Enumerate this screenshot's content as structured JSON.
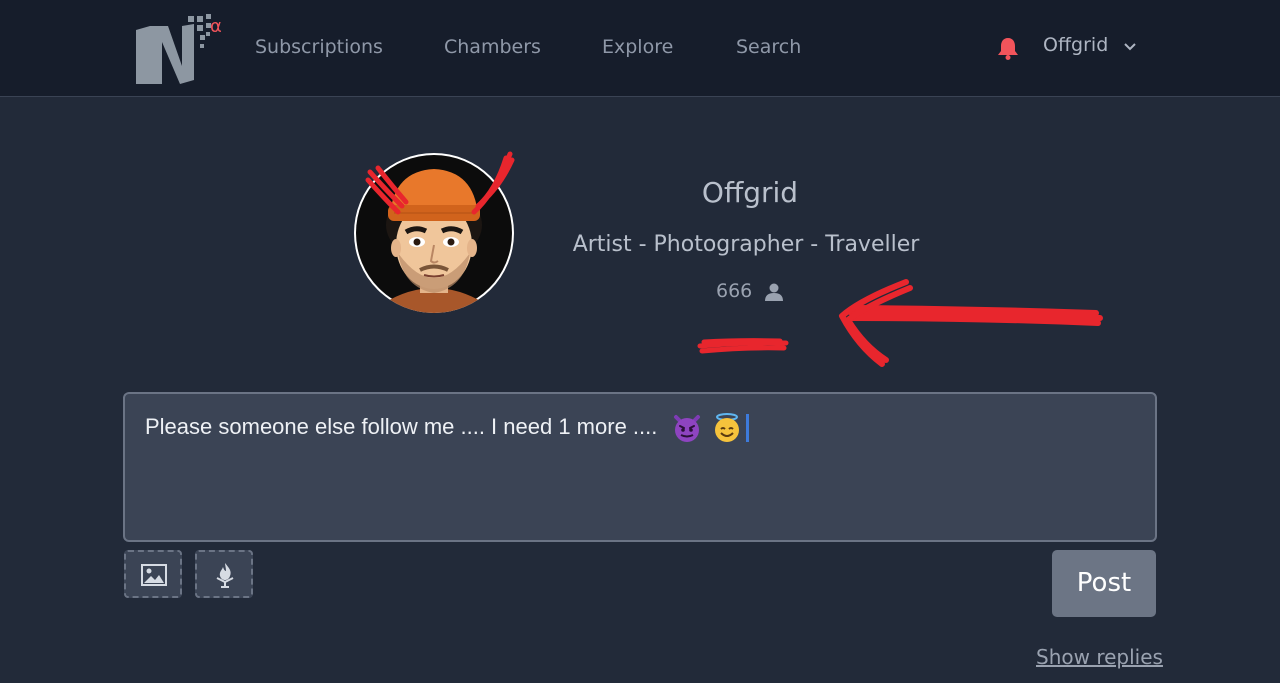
{
  "nav": {
    "logo_superscript": "α",
    "links": [
      "Subscriptions",
      "Chambers",
      "Explore",
      "Search"
    ],
    "username": "Offgrid",
    "icons": {
      "bell": "bell-icon",
      "chevron": "chevron-down-icon"
    }
  },
  "profile": {
    "name": "Offgrid",
    "bio": "Artist - Photographer - Traveller",
    "followers": "666"
  },
  "composer": {
    "text": "Please someone else follow me .... I need 1 more .... ",
    "emojis": [
      "smiling-imp",
      "smiling-face-with-halo"
    ]
  },
  "toolbar": {
    "image_icon": "image-icon",
    "flame_icon": "flame-icon",
    "post_label": "Post"
  },
  "footer": {
    "show_replies": "Show replies"
  },
  "colors": {
    "background": "#222a39",
    "navbar": "#161d2b",
    "accent_red": "#f2545b",
    "annotation_red": "#e8262d",
    "button_gray": "#6c7585"
  }
}
